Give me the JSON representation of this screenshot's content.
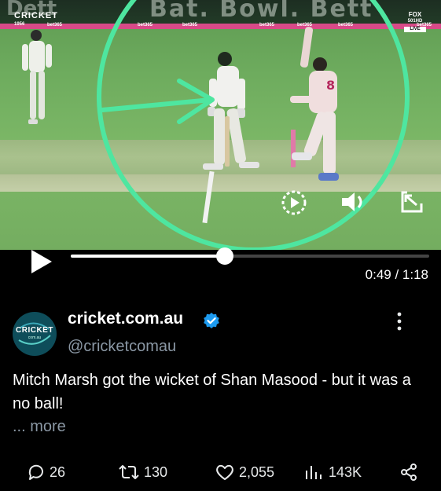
{
  "video": {
    "stand_text": "Bat. Bowl. Bett",
    "stand_text_left": "Dett",
    "ads": [
      "bet365",
      "bet365",
      "bet365",
      "bet365",
      "bet365",
      "bet365",
      "bet365"
    ],
    "brand_logo": "CRICKET",
    "brand_logo_sub": "1956",
    "fox_badge": "FOX",
    "fox_live_top": "501HD",
    "fox_live": "LIVE",
    "overlay_color": "#4ee6a0",
    "progress": 0.43,
    "time_display": "0:49 / 1:18"
  },
  "post": {
    "avatar_text": "CRICKET",
    "avatar_sub": "com.au",
    "display_name": "cricket.com.au",
    "handle": "@cricketcomau",
    "text": "Mitch Marsh got the wicket of Shan Masood - but it was a no ball!",
    "more_label": "... more"
  },
  "actions": {
    "replies": "26",
    "reposts": "130",
    "likes": "2,055",
    "views": "143K"
  },
  "colors": {
    "background": "#000000",
    "muted_text": "#8b98a5",
    "verified": "#1d9bf0"
  }
}
